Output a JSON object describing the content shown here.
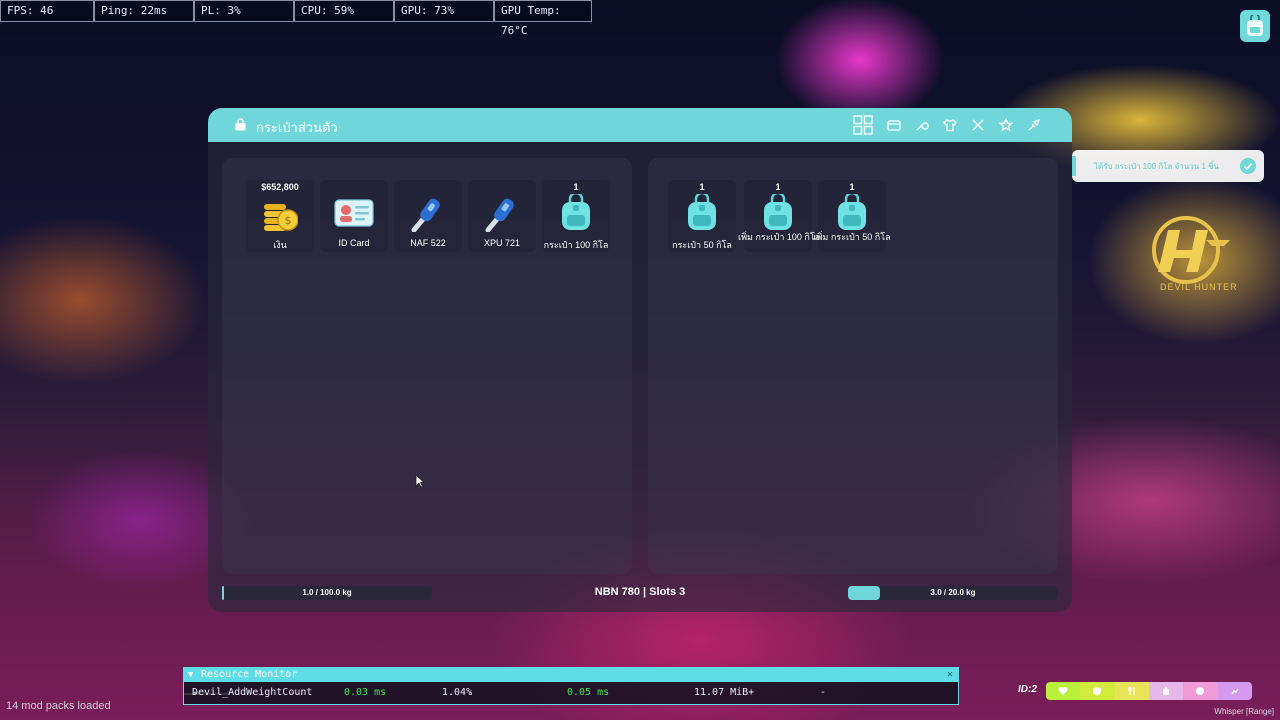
{
  "perf": {
    "fps": "FPS: 46",
    "ping": "Ping: 22ms",
    "pl": "PL: 3%",
    "cpu": "CPU: 59%",
    "gpu": "GPU: 73%",
    "gpu_temp": "GPU Temp: 76°C"
  },
  "inventory": {
    "title": "กระเป๋าส่วนตัว",
    "player_items": [
      {
        "count": "$652,800",
        "label": "เงิน",
        "icon": "coins-icon"
      },
      {
        "count": "",
        "label": "ID Card",
        "icon": "id-card-icon"
      },
      {
        "count": "",
        "label": "NAF 522",
        "icon": "key-icon"
      },
      {
        "count": "",
        "label": "XPU 721",
        "icon": "key-icon"
      },
      {
        "count": "1",
        "label": "กระเป๋า 100 กิโล",
        "icon": "backpack-icon"
      }
    ],
    "vehicle_items": [
      {
        "count": "1",
        "label": "กระเป๋า 50 กิโล",
        "icon": "backpack-icon"
      },
      {
        "count": "1",
        "label": "เพิ่ม กระเป๋า 100 กิโล",
        "icon": "backpack-icon"
      },
      {
        "count": "1",
        "label": "เพิ่ม กระเป๋า 50 กิโล",
        "icon": "backpack-icon"
      }
    ],
    "player_weight": "1.0 / 100.0 kg",
    "player_weight_fraction": 0.01,
    "vehicle_info": "NBN 780 | Slots 3",
    "vehicle_weight": "3.0 / 20.0 kg",
    "vehicle_weight_fraction": 0.15
  },
  "notification": {
    "text": "ได้รับ กระเป๋า 100 กิโล จำนวน 1 ชิ้น"
  },
  "logo": {
    "text": "DEVIL HUNTER"
  },
  "resource_monitor": {
    "title": "Resource Monitor",
    "row": {
      "name": "Devil_AddWeightCount",
      "cpu_ms": "0.03 ms",
      "percent": "1.04%",
      "time_ms": "0.05 ms",
      "memory": "11.07 MiB+",
      "extra": "-"
    }
  },
  "footer": {
    "mods": "14 mod packs loaded",
    "id": "ID:2",
    "voice": "Whisper [Range]"
  },
  "colors": {
    "accent": "#6fd6d9",
    "monitor": "#5edde6",
    "green_value": "#3be84f"
  }
}
